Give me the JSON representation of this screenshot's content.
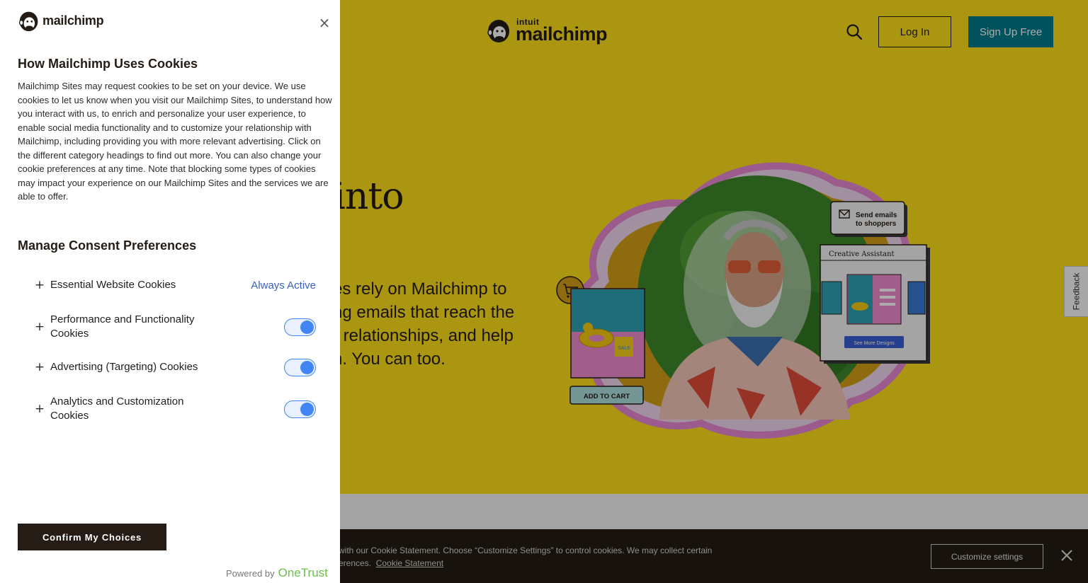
{
  "site": {
    "logo_top": "intuit",
    "logo_name": "mailchimp",
    "login_label": "Log In",
    "signup_label": "Sign Up Free",
    "hero_heading": "s into",
    "hero_copy": [
      "es rely on Mailchimp to",
      "ng emails that reach the",
      "r relationships, and help",
      "h. You can too."
    ],
    "art": {
      "send_emails": [
        "Send emails",
        "to shoppers"
      ],
      "creative_assistant": "Creative Assistant",
      "see_more": "See More Designs",
      "add_to_cart": "ADD TO CART",
      "badge": "SALE"
    },
    "feedback_label": "Feedback"
  },
  "banner": {
    "text_line1": "with our Cookie Statement. Choose “Customize Settings” to control cookies. We may collect certain",
    "text_line2": "erences.",
    "cookie_statement_link": "Cookie Statement",
    "customize_label": "Customize settings"
  },
  "panel": {
    "logo_name": "mailchimp",
    "title": "How Mailchimp Uses Cookies",
    "description": "Mailchimp Sites may request cookies to be set on your device. We use cookies to let us know when you visit our Mailchimp Sites, to understand how you interact with us, to enrich and personalize your user experience, to enable social media functionality and to customize your relationship with Mailchimp, including providing you with more relevant advertising. Click on the different category headings to find out more. You can also change your cookie preferences at any time. Note that blocking some types of cookies may impact your experience on our Mailchimp Sites and the services we are able to offer.",
    "consent_title": "Manage Consent Preferences",
    "categories": [
      {
        "label": "Essential Website Cookies",
        "status": "Always Active"
      },
      {
        "label": "Performance and Functionality Cookies",
        "enabled": true
      },
      {
        "label": "Advertising (Targeting) Cookies",
        "enabled": true
      },
      {
        "label": "Analytics and Customization Cookies",
        "enabled": true
      }
    ],
    "confirm_label": "Confirm My Choices",
    "powered_by": "Powered by",
    "powered_brand": "OneTrust"
  },
  "colors": {
    "hero_yellow": "#ffe01b",
    "teal": "#007c89",
    "toggle_blue": "#4285f4",
    "banner_dark": "#241c15",
    "always_active": "#3860be"
  }
}
